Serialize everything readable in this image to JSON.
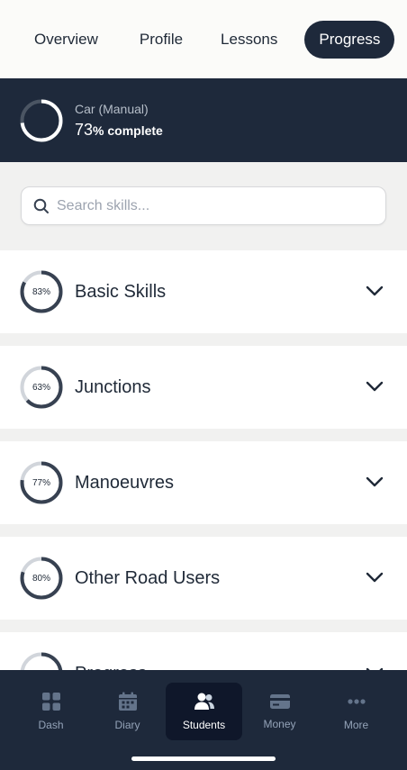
{
  "tabs": [
    {
      "label": "Overview"
    },
    {
      "label": "Profile"
    },
    {
      "label": "Lessons"
    },
    {
      "label": "Progress",
      "active": true
    }
  ],
  "summary": {
    "course": "Car (Manual)",
    "percent": "73",
    "percent_suffix": "% complete",
    "progress_fraction": 0.73
  },
  "search": {
    "placeholder": "Search skills...",
    "value": ""
  },
  "skills": [
    {
      "title": "Basic Skills",
      "percent_label": "83%",
      "fraction": 0.83
    },
    {
      "title": "Junctions",
      "percent_label": "63%",
      "fraction": 0.63
    },
    {
      "title": "Manoeuvres",
      "percent_label": "77%",
      "fraction": 0.77
    },
    {
      "title": "Other Road Users",
      "percent_label": "80%",
      "fraction": 0.8
    },
    {
      "title": "Progress",
      "percent_label": "",
      "fraction": 0.25
    }
  ],
  "nav": [
    {
      "label": "Dash",
      "icon": "dashboard-icon"
    },
    {
      "label": "Diary",
      "icon": "calendar-icon"
    },
    {
      "label": "Students",
      "icon": "students-icon",
      "active": true
    },
    {
      "label": "Money",
      "icon": "card-icon"
    },
    {
      "label": "More",
      "icon": "more-icon"
    }
  ],
  "colors": {
    "dark": "#1e293b",
    "ring_fill": "#374151",
    "ring_track": "#d1d5db",
    "muted": "#94a3b8"
  }
}
